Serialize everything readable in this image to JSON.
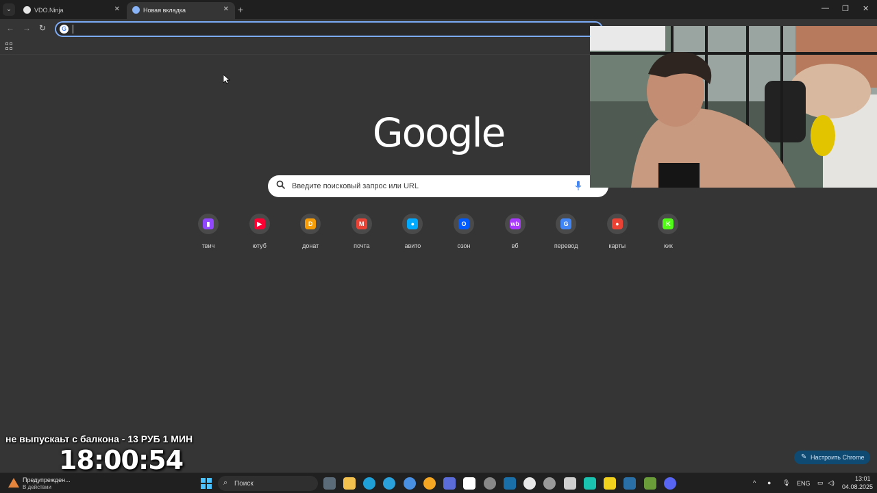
{
  "tabs": [
    {
      "title": "VDO.Ninja",
      "active": false,
      "favicon_color": "#e5e5e5"
    },
    {
      "title": "Новая вкладка",
      "active": true,
      "favicon_color": "#8ab4f8"
    }
  ],
  "omnibox": {
    "value": "",
    "placeholder": ""
  },
  "newtab": {
    "logo": "Google",
    "search_placeholder": "Введите поисковый запрос или URL",
    "shortcuts": [
      {
        "label": "твич",
        "icon": "twitch-icon",
        "color": "#9146ff",
        "glyph": "▮"
      },
      {
        "label": "ютуб",
        "icon": "youtube-icon",
        "color": "#ff0033",
        "glyph": "▶"
      },
      {
        "label": "донат",
        "icon": "donationalerts-icon",
        "color": "#f59c07",
        "glyph": "D"
      },
      {
        "label": "почта",
        "icon": "gmail-icon",
        "color": "#ea4335",
        "glyph": "M"
      },
      {
        "label": "авито",
        "icon": "avito-icon",
        "color": "#00aaff",
        "glyph": "●"
      },
      {
        "label": "озон",
        "icon": "ozon-icon",
        "color": "#005bff",
        "glyph": "O"
      },
      {
        "label": "вб",
        "icon": "wildberries-icon",
        "color": "#a73afd",
        "glyph": "wb"
      },
      {
        "label": "перевод",
        "icon": "translate-icon",
        "color": "#4285f4",
        "glyph": "G"
      },
      {
        "label": "карты",
        "icon": "maps-pin-icon",
        "color": "#ea4335",
        "glyph": "●"
      },
      {
        "label": "кик",
        "icon": "kick-icon",
        "color": "#53fc18",
        "glyph": "K"
      }
    ],
    "customize_label": "Настроить Chrome"
  },
  "stream": {
    "overlay_text": "не выпускаьт с балкона - 13 РУБ 1 МИН",
    "timer": "18:00:54"
  },
  "taskbar": {
    "warning_title": "Предупрежден...",
    "warning_sub": "В действии",
    "search_label": "Поиск",
    "language": "ENG",
    "time": "13:01",
    "date": "04.08.2025"
  }
}
